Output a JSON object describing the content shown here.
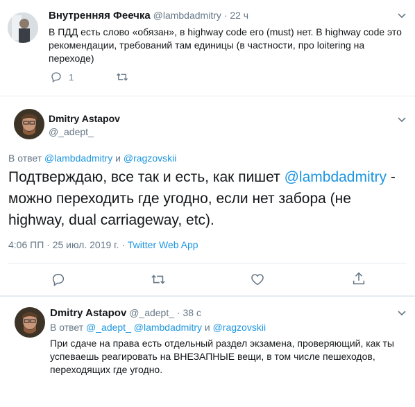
{
  "tweet1": {
    "name": "Внутренняя Феечка",
    "handle": "@lambdadmitry",
    "dot": "·",
    "time": "22 ч",
    "text": "В ПДД есть слово «обязан», в highway code его (must) нет. В highway code это рекомендации, требований там единицы (в частности, про loitering на переходе)",
    "reply_count": "1"
  },
  "main": {
    "name": "Dmitry Astapov",
    "handle": "@_adept_",
    "reply_prefix": "В ответ",
    "reply_users": [
      "@lambdadmitry",
      "и",
      "@ragzovskii"
    ],
    "text_part1": "Подтверждаю, все так и есть, как пишет",
    "mention": "@lambdadmitry",
    "text_part2": "- можно переходить где угодно, если нет забора (не highway, dual carriageway, etc).",
    "timestamp": "4:06 ПП · 25 июл. 2019 г.",
    "dot": "·",
    "source": "Twitter Web App"
  },
  "reply": {
    "name": "Dmitry Astapov",
    "handle": "@_adept_",
    "dot": "·",
    "time": "38 с",
    "reply_prefix": "В ответ",
    "reply_users": [
      "@_adept_",
      "@lambdadmitry",
      "и",
      "@ragzovskii"
    ],
    "text": "При сдаче на права есть отдельный раздел экзамена, проверяющий, как ты успеваешь реагировать на ВНЕЗАПНЫЕ вещи, в том числе пешеходов, переходящих где угодно."
  },
  "colors": {
    "accent": "#1b95e0",
    "muted": "#657786",
    "border": "#e6ecf0"
  },
  "icons": [
    "chevron-down-icon",
    "reply-icon",
    "retweet-icon",
    "like-icon",
    "share-icon"
  ]
}
